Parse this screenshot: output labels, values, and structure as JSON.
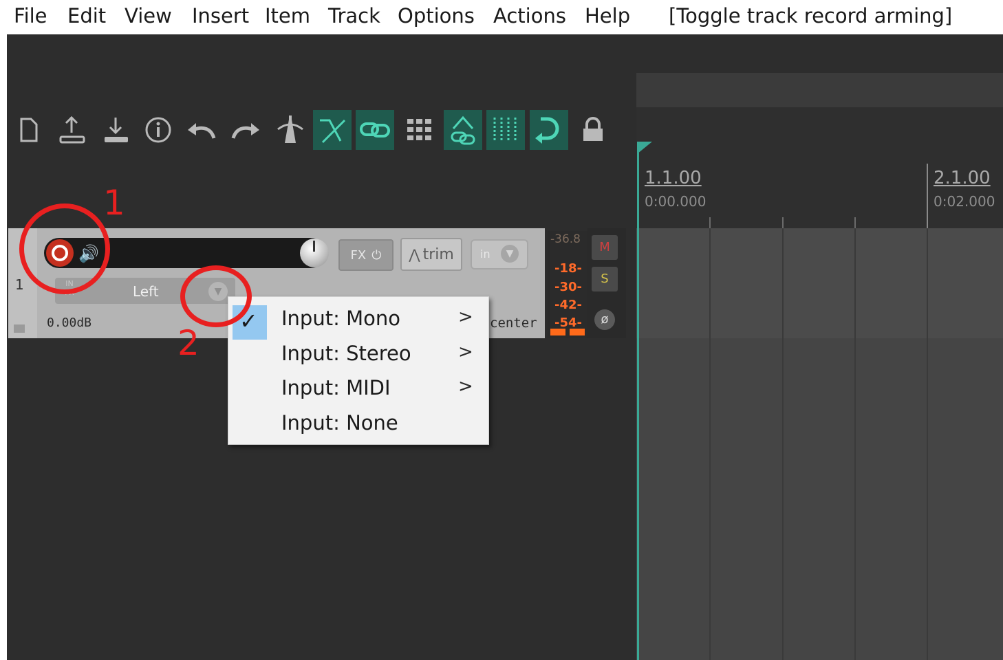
{
  "menubar": {
    "items": [
      "File",
      "Edit",
      "View",
      "Insert",
      "Item",
      "Track",
      "Options",
      "Actions",
      "Help"
    ],
    "action_text": "[Toggle track record arming]"
  },
  "toolbar": {
    "icons": [
      "new-project-icon",
      "open-project-icon",
      "save-project-icon",
      "project-info-icon",
      "undo-icon",
      "redo-icon",
      "metronome-icon",
      "auto-crossfade-icon",
      "item-grouping-icon",
      "grid-dots-icon",
      "envelope-lock-icon",
      "snap-grid-icon",
      "ripple-edit-icon",
      "lock-icon"
    ],
    "active": [
      "auto-crossfade-icon",
      "item-grouping-icon",
      "envelope-lock-icon",
      "snap-grid-icon",
      "ripple-edit-icon"
    ]
  },
  "ruler": {
    "markers": [
      {
        "bar": "1.1.00",
        "time": "0:00.000"
      },
      {
        "bar": "2.1.00",
        "time": "0:02.000"
      }
    ]
  },
  "track": {
    "number": "1",
    "input": "Left",
    "input_fx": "IN\nFX",
    "volume": "0.00dB",
    "pan": "center",
    "fx_label": "FX",
    "trim_label": "trim",
    "in_label": "in",
    "record_armed": true
  },
  "meter": {
    "peak": "-36.8",
    "ticks": [
      "-18-",
      "-30-",
      "-42-",
      "-54-"
    ],
    "mute": "M",
    "solo": "S",
    "phase": "ø"
  },
  "context_menu": {
    "items": [
      {
        "label": "Input: Mono",
        "checked": true,
        "submenu": true
      },
      {
        "label": "Input: Stereo",
        "checked": false,
        "submenu": true
      },
      {
        "label": "Input: MIDI",
        "checked": false,
        "submenu": true
      },
      {
        "label": "Input: None",
        "checked": false,
        "submenu": false
      }
    ],
    "check_glyph": "✓",
    "arrow_glyph": ">"
  },
  "annotations": {
    "one": "1",
    "two": "2",
    "color": "#e82020"
  },
  "colors": {
    "accent": "#3aa996",
    "record": "#c5301f",
    "meter": "#ff6a2a"
  }
}
